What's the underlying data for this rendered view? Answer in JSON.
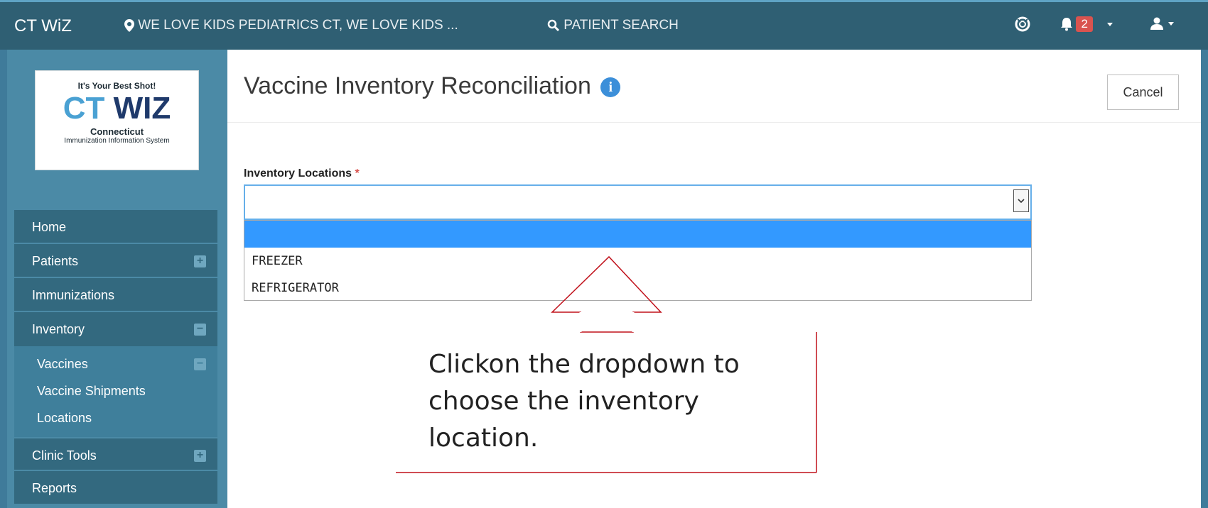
{
  "navbar": {
    "brand": "CT WiZ",
    "location": "WE LOVE KIDS PEDIATRICS CT, WE LOVE KIDS ...",
    "patient_search": "PATIENT SEARCH",
    "notification_count": "2"
  },
  "logo": {
    "tagline": "It's Your Best Shot!",
    "ct": "CT",
    "wiz": "WIZ",
    "state": "Connecticut",
    "system": "Immunization Information System"
  },
  "sidebar": {
    "items": [
      {
        "label": "Home"
      },
      {
        "label": "Patients",
        "toggle": "+"
      },
      {
        "label": "Immunizations"
      },
      {
        "label": "Inventory",
        "toggle": "−"
      },
      {
        "label": "Clinic Tools",
        "toggle": "+"
      },
      {
        "label": "Reports"
      }
    ],
    "inventory_subitems": [
      {
        "label": "Vaccines",
        "toggle": "−"
      },
      {
        "label": "Vaccine Shipments"
      },
      {
        "label": "Locations"
      }
    ]
  },
  "page": {
    "title": "Vaccine Inventory Reconciliation",
    "info_icon": "i",
    "cancel_label": "Cancel"
  },
  "form": {
    "label": "Inventory Locations",
    "required_mark": "*",
    "selected_value": "",
    "options": [
      "",
      "FREEZER",
      "REFRIGERATOR"
    ]
  },
  "annotation": {
    "text": "Clickon the dropdown to choose the inventory location."
  },
  "colors": {
    "navbar": "#2f5f73",
    "sidebar": "#4b8aa6",
    "menu_item": "#33697f",
    "selected_option": "#3399ff",
    "badge": "#d9534f",
    "annotation_line": "#c0101a"
  },
  "icons": {
    "location": "map-marker-icon",
    "search": "search-icon",
    "help": "life-ring-icon",
    "notifications": "bell-icon",
    "user": "user-icon"
  }
}
